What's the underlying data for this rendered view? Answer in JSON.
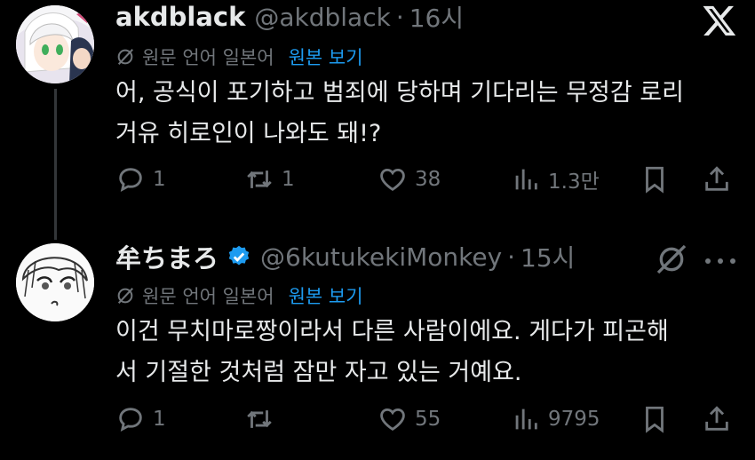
{
  "tweets": [
    {
      "display_name": "akdblack",
      "handle": "@akdblack",
      "separator": "·",
      "time": "16시",
      "translate_label": "원문 언어 일본어",
      "show_original": "원본 보기",
      "text_lines": [
        "어, 공식이 포기하고 범죄에 당하며 기다리는 무정감 로리",
        "거유 히로인이 나와도 돼!?"
      ],
      "replies": "1",
      "retweets": "1",
      "likes": "38",
      "views": "1.3만",
      "verified": false
    },
    {
      "display_name": "牟ちまろ",
      "handle": "@6kutukekiMonkey",
      "separator": "·",
      "time": "15시",
      "translate_label": "원문 언어 일본어",
      "show_original": "원본 보기",
      "text_lines": [
        "이건 무치마로짱이라서 다른 사람이에요. 게다가 피곤해",
        "서 기절한 것처럼 잠만 자고 있는 거예요."
      ],
      "replies": "1",
      "retweets": "",
      "likes": "55",
      "views": "9795",
      "verified": true
    }
  ],
  "icons": {
    "reply": "speech-bubble-icon",
    "retweet": "repost-arrows-icon",
    "like": "heart-icon",
    "views": "bar-chart-icon",
    "bookmark": "bookmark-icon",
    "share": "share-upload-icon",
    "brand": "x-logo-icon",
    "more": "more-dots-icon",
    "translate": "translate-slash-icon"
  },
  "colors": {
    "background": "#000000",
    "text": "#e7e9ea",
    "secondary": "#71767b",
    "link": "#1d9bf0",
    "verified": "#1d9bf0",
    "thread_line": "#333639"
  }
}
